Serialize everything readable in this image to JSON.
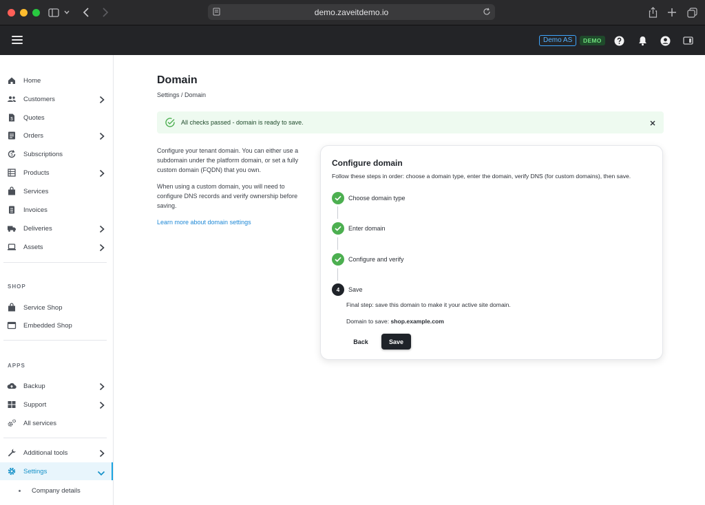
{
  "browser": {
    "url": "demo.zaveitdemo.io"
  },
  "header": {
    "tenant_badge": "Demo AS",
    "env_badge": "DEMO"
  },
  "sidebar": {
    "items": [
      {
        "label": "Home",
        "icon": "home-icon"
      },
      {
        "label": "Customers",
        "icon": "users-icon",
        "expandable": true
      },
      {
        "label": "Quotes",
        "icon": "document-dollar-icon"
      },
      {
        "label": "Orders",
        "icon": "list-icon",
        "expandable": true
      },
      {
        "label": "Subscriptions",
        "icon": "refresh-dollar-icon"
      },
      {
        "label": "Products",
        "icon": "grid-list-icon",
        "expandable": true
      },
      {
        "label": "Services",
        "icon": "bag-icon"
      },
      {
        "label": "Invoices",
        "icon": "receipt-icon"
      },
      {
        "label": "Deliveries",
        "icon": "truck-icon",
        "expandable": true
      },
      {
        "label": "Assets",
        "icon": "laptop-icon",
        "expandable": true
      }
    ],
    "shop_section": "SHOP",
    "shop_items": [
      {
        "label": "Service Shop",
        "icon": "shop-bag-icon"
      },
      {
        "label": "Embedded Shop",
        "icon": "window-icon"
      }
    ],
    "apps_section": "APPS",
    "apps_items": [
      {
        "label": "Backup",
        "icon": "cloud-upload-icon",
        "expandable": true
      },
      {
        "label": "Support",
        "icon": "support-grid-icon",
        "expandable": true
      },
      {
        "label": "All services",
        "icon": "cogs-icon"
      }
    ],
    "bottom_items": [
      {
        "label": "Additional tools",
        "icon": "wrench-icon",
        "expandable": true
      },
      {
        "label": "Settings",
        "icon": "gear-icon",
        "expanded": true,
        "active": true
      }
    ],
    "sub_items": [
      {
        "label": "Company details"
      }
    ]
  },
  "main": {
    "title": "Domain",
    "breadcrumb": "Settings / Domain",
    "alert": "All checks passed - domain is ready to save.",
    "intro_p1": "Configure your tenant domain. You can either use a subdomain under the platform domain, or set a fully custom domain (FQDN) that you own.",
    "intro_p2": "When using a custom domain, you will need to configure DNS records and verify ownership before saving.",
    "learn_more": "Learn more about domain settings"
  },
  "card": {
    "title": "Configure domain",
    "description": "Follow these steps in order: choose a domain type, enter the domain, verify DNS (for custom domains), then save.",
    "steps": [
      {
        "label": "Choose domain type",
        "status": "done"
      },
      {
        "label": "Enter domain",
        "status": "done"
      },
      {
        "label": "Configure and verify",
        "status": "done"
      },
      {
        "label": "Save",
        "status": "current",
        "number": "4"
      }
    ],
    "final_text": "Final step: save this domain to make it your active site domain.",
    "domain_label": "Domain to save:",
    "domain_value": "shop.example.com",
    "back_label": "Back",
    "save_label": "Save"
  },
  "colors": {
    "accent": "#1aa3e0",
    "success": "#4caf50",
    "header_bg": "#232427",
    "primary_button": "#1f2329"
  }
}
